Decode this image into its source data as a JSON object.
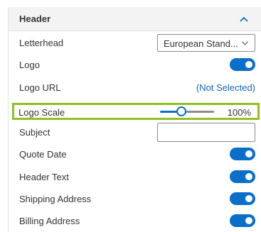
{
  "section": {
    "title": "Header"
  },
  "rows": {
    "letterhead": {
      "label": "Letterhead",
      "value": "European Stand..."
    },
    "logo": {
      "label": "Logo",
      "on": true
    },
    "logo_url": {
      "label": "Logo URL",
      "link": "(Not Selected)"
    },
    "logo_scale": {
      "label": "Logo Scale",
      "value_text": "100%",
      "level": 0.4
    },
    "subject": {
      "label": "Subject",
      "value": "",
      "placeholder": ""
    },
    "quote_date": {
      "label": "Quote Date",
      "on": true
    },
    "header_text": {
      "label": "Header Text",
      "on": true
    },
    "shipping_address": {
      "label": "Shipping Address",
      "on": true
    },
    "billing_address": {
      "label": "Billing Address",
      "on": true
    }
  },
  "colors": {
    "accent": "#0a6fc9",
    "highlight": "#8dc21f",
    "link": "#1565c0"
  },
  "icons": {
    "collapse": "chevron-up-icon",
    "dropdown": "chevron-down-icon"
  }
}
